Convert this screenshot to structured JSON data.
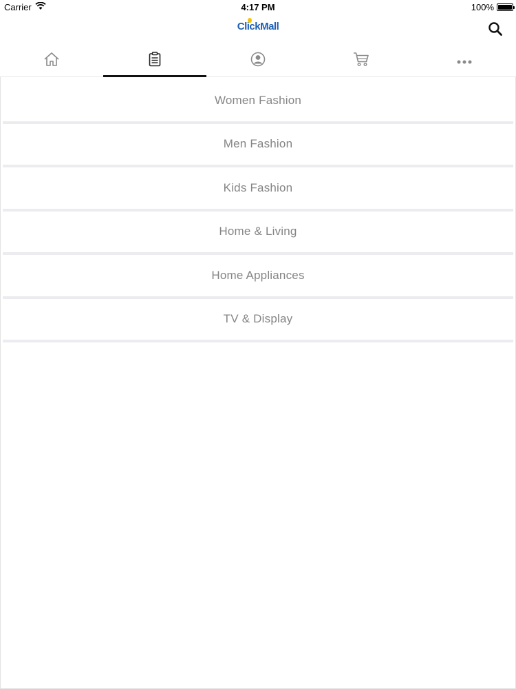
{
  "status_bar": {
    "carrier": "Carrier",
    "time": "4:17 PM",
    "battery": "100%",
    "battery_level": 1.0
  },
  "header": {
    "logo_text": "ClickMall",
    "logo_color": "#1d5fb6",
    "logo_accent_color": "#f5c400",
    "search_icon": "search-icon"
  },
  "tabs": [
    {
      "icon": "home-icon",
      "active": false
    },
    {
      "icon": "clipboard-icon",
      "active": true
    },
    {
      "icon": "account-icon",
      "active": false
    },
    {
      "icon": "cart-icon",
      "active": false
    },
    {
      "icon": "more-icon",
      "active": false
    }
  ],
  "categories": [
    {
      "label": "Women Fashion"
    },
    {
      "label": "Men Fashion"
    },
    {
      "label": "Kids Fashion"
    },
    {
      "label": "Home & Living"
    },
    {
      "label": "Home Appliances"
    },
    {
      "label": "TV & Display"
    }
  ]
}
